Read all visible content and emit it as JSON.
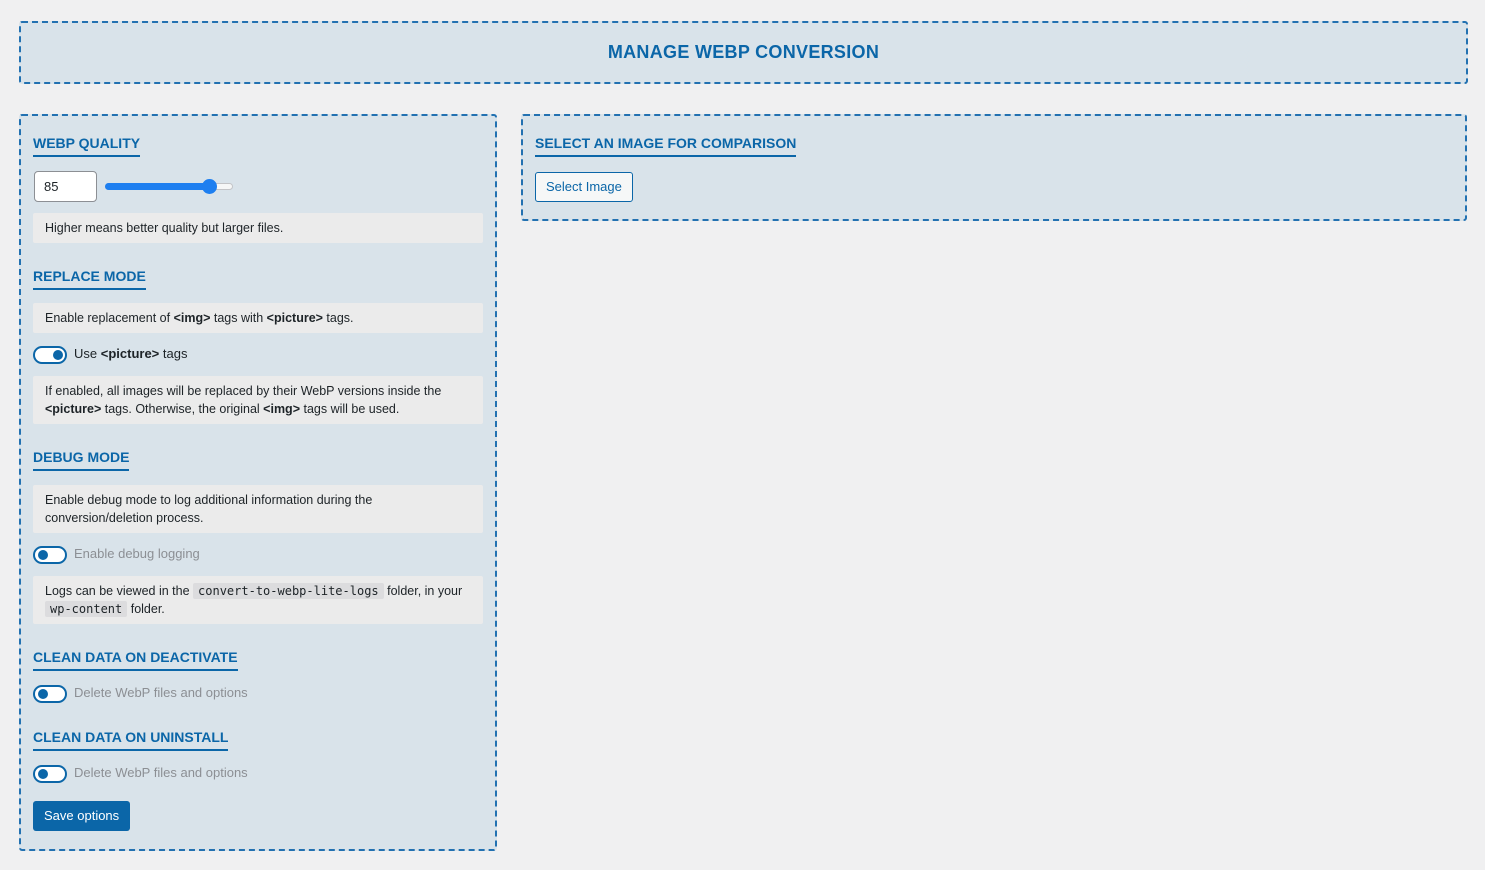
{
  "header": {
    "title": "MANAGE WEBP CONVERSION"
  },
  "quality": {
    "title": "WEBP QUALITY",
    "value": "85",
    "slider_fraction": 0.82,
    "hint": "Higher means better quality but larger files."
  },
  "replace": {
    "title": "REPLACE MODE",
    "desc_prefix": "Enable replacement of ",
    "desc_tag1": "<img>",
    "desc_mid": " tags with ",
    "desc_tag2": "<picture>",
    "desc_suffix": " tags.",
    "toggle_prefix": "Use ",
    "toggle_tag": "<picture>",
    "toggle_suffix": " tags",
    "toggle_on": true,
    "note_prefix": "If enabled, all images will be replaced by their WebP versions inside the ",
    "note_tag1": "<picture>",
    "note_mid": " tags. Otherwise, the original ",
    "note_tag2": "<img>",
    "note_suffix": " tags will be used."
  },
  "debug": {
    "title": "DEBUG MODE",
    "desc": "Enable debug mode to log additional information during the conversion/deletion process.",
    "toggle_label": "Enable debug logging",
    "toggle_on": false,
    "note_prefix": "Logs can be viewed in the ",
    "note_code1": "convert-to-webp-lite-logs",
    "note_mid": " folder, in your ",
    "note_code2": "wp-content",
    "note_suffix": " folder."
  },
  "deactivate": {
    "title_prefix": "CLEAN DATA ON ",
    "title_strong": "DEACTIVATE",
    "toggle_label": "Delete WebP files and options",
    "toggle_on": false
  },
  "uninstall": {
    "title_prefix": "CLEAN DATA ON ",
    "title_strong": "UNINSTALL",
    "toggle_label": "Delete WebP files and options",
    "toggle_on": false
  },
  "save_label": "Save options",
  "comparison": {
    "title": "SELECT AN IMAGE FOR COMPARISON",
    "button_label": "Select Image"
  },
  "colors": {
    "accent": "#0b66a8",
    "panel_bg": "#d9e3ea",
    "slider": "#1e7ff0"
  }
}
